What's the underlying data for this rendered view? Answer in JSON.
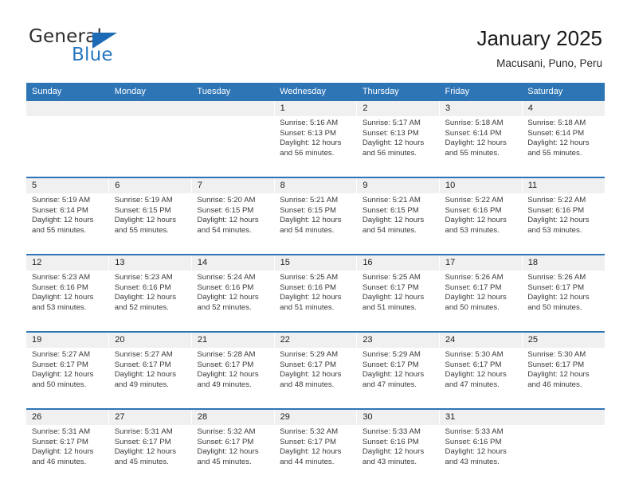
{
  "logo": {
    "word1": "General",
    "word2": "Blue",
    "triangle_color": "#1d6bb5",
    "word2_color": "#2477c0"
  },
  "header": {
    "title": "January 2025",
    "subtitle": "Macusani, Puno, Peru"
  },
  "theme": {
    "header_blue": "#2e75b6",
    "daynum_band": "#f0f0f0",
    "text": "#202020"
  },
  "weekday_headers": [
    "Sunday",
    "Monday",
    "Tuesday",
    "Wednesday",
    "Thursday",
    "Friday",
    "Saturday"
  ],
  "labels": {
    "sunrise_prefix": "Sunrise:",
    "sunset_prefix": "Sunset:",
    "daylight_prefix": "Daylight:"
  },
  "weeks": [
    {
      "days": [
        {
          "num": "",
          "empty": true
        },
        {
          "num": "",
          "empty": true
        },
        {
          "num": "",
          "empty": true
        },
        {
          "num": "1",
          "sunrise": "Sunrise: 5:16 AM",
          "sunset": "Sunset: 6:13 PM",
          "daylight1": "Daylight: 12 hours",
          "daylight2": "and 56 minutes."
        },
        {
          "num": "2",
          "sunrise": "Sunrise: 5:17 AM",
          "sunset": "Sunset: 6:13 PM",
          "daylight1": "Daylight: 12 hours",
          "daylight2": "and 56 minutes."
        },
        {
          "num": "3",
          "sunrise": "Sunrise: 5:18 AM",
          "sunset": "Sunset: 6:14 PM",
          "daylight1": "Daylight: 12 hours",
          "daylight2": "and 55 minutes."
        },
        {
          "num": "4",
          "sunrise": "Sunrise: 5:18 AM",
          "sunset": "Sunset: 6:14 PM",
          "daylight1": "Daylight: 12 hours",
          "daylight2": "and 55 minutes."
        }
      ]
    },
    {
      "days": [
        {
          "num": "5",
          "sunrise": "Sunrise: 5:19 AM",
          "sunset": "Sunset: 6:14 PM",
          "daylight1": "Daylight: 12 hours",
          "daylight2": "and 55 minutes."
        },
        {
          "num": "6",
          "sunrise": "Sunrise: 5:19 AM",
          "sunset": "Sunset: 6:15 PM",
          "daylight1": "Daylight: 12 hours",
          "daylight2": "and 55 minutes."
        },
        {
          "num": "7",
          "sunrise": "Sunrise: 5:20 AM",
          "sunset": "Sunset: 6:15 PM",
          "daylight1": "Daylight: 12 hours",
          "daylight2": "and 54 minutes."
        },
        {
          "num": "8",
          "sunrise": "Sunrise: 5:21 AM",
          "sunset": "Sunset: 6:15 PM",
          "daylight1": "Daylight: 12 hours",
          "daylight2": "and 54 minutes."
        },
        {
          "num": "9",
          "sunrise": "Sunrise: 5:21 AM",
          "sunset": "Sunset: 6:15 PM",
          "daylight1": "Daylight: 12 hours",
          "daylight2": "and 54 minutes."
        },
        {
          "num": "10",
          "sunrise": "Sunrise: 5:22 AM",
          "sunset": "Sunset: 6:16 PM",
          "daylight1": "Daylight: 12 hours",
          "daylight2": "and 53 minutes."
        },
        {
          "num": "11",
          "sunrise": "Sunrise: 5:22 AM",
          "sunset": "Sunset: 6:16 PM",
          "daylight1": "Daylight: 12 hours",
          "daylight2": "and 53 minutes."
        }
      ]
    },
    {
      "days": [
        {
          "num": "12",
          "sunrise": "Sunrise: 5:23 AM",
          "sunset": "Sunset: 6:16 PM",
          "daylight1": "Daylight: 12 hours",
          "daylight2": "and 53 minutes."
        },
        {
          "num": "13",
          "sunrise": "Sunrise: 5:23 AM",
          "sunset": "Sunset: 6:16 PM",
          "daylight1": "Daylight: 12 hours",
          "daylight2": "and 52 minutes."
        },
        {
          "num": "14",
          "sunrise": "Sunrise: 5:24 AM",
          "sunset": "Sunset: 6:16 PM",
          "daylight1": "Daylight: 12 hours",
          "daylight2": "and 52 minutes."
        },
        {
          "num": "15",
          "sunrise": "Sunrise: 5:25 AM",
          "sunset": "Sunset: 6:16 PM",
          "daylight1": "Daylight: 12 hours",
          "daylight2": "and 51 minutes."
        },
        {
          "num": "16",
          "sunrise": "Sunrise: 5:25 AM",
          "sunset": "Sunset: 6:17 PM",
          "daylight1": "Daylight: 12 hours",
          "daylight2": "and 51 minutes."
        },
        {
          "num": "17",
          "sunrise": "Sunrise: 5:26 AM",
          "sunset": "Sunset: 6:17 PM",
          "daylight1": "Daylight: 12 hours",
          "daylight2": "and 50 minutes."
        },
        {
          "num": "18",
          "sunrise": "Sunrise: 5:26 AM",
          "sunset": "Sunset: 6:17 PM",
          "daylight1": "Daylight: 12 hours",
          "daylight2": "and 50 minutes."
        }
      ]
    },
    {
      "days": [
        {
          "num": "19",
          "sunrise": "Sunrise: 5:27 AM",
          "sunset": "Sunset: 6:17 PM",
          "daylight1": "Daylight: 12 hours",
          "daylight2": "and 50 minutes."
        },
        {
          "num": "20",
          "sunrise": "Sunrise: 5:27 AM",
          "sunset": "Sunset: 6:17 PM",
          "daylight1": "Daylight: 12 hours",
          "daylight2": "and 49 minutes."
        },
        {
          "num": "21",
          "sunrise": "Sunrise: 5:28 AM",
          "sunset": "Sunset: 6:17 PM",
          "daylight1": "Daylight: 12 hours",
          "daylight2": "and 49 minutes."
        },
        {
          "num": "22",
          "sunrise": "Sunrise: 5:29 AM",
          "sunset": "Sunset: 6:17 PM",
          "daylight1": "Daylight: 12 hours",
          "daylight2": "and 48 minutes."
        },
        {
          "num": "23",
          "sunrise": "Sunrise: 5:29 AM",
          "sunset": "Sunset: 6:17 PM",
          "daylight1": "Daylight: 12 hours",
          "daylight2": "and 47 minutes."
        },
        {
          "num": "24",
          "sunrise": "Sunrise: 5:30 AM",
          "sunset": "Sunset: 6:17 PM",
          "daylight1": "Daylight: 12 hours",
          "daylight2": "and 47 minutes."
        },
        {
          "num": "25",
          "sunrise": "Sunrise: 5:30 AM",
          "sunset": "Sunset: 6:17 PM",
          "daylight1": "Daylight: 12 hours",
          "daylight2": "and 46 minutes."
        }
      ]
    },
    {
      "days": [
        {
          "num": "26",
          "sunrise": "Sunrise: 5:31 AM",
          "sunset": "Sunset: 6:17 PM",
          "daylight1": "Daylight: 12 hours",
          "daylight2": "and 46 minutes."
        },
        {
          "num": "27",
          "sunrise": "Sunrise: 5:31 AM",
          "sunset": "Sunset: 6:17 PM",
          "daylight1": "Daylight: 12 hours",
          "daylight2": "and 45 minutes."
        },
        {
          "num": "28",
          "sunrise": "Sunrise: 5:32 AM",
          "sunset": "Sunset: 6:17 PM",
          "daylight1": "Daylight: 12 hours",
          "daylight2": "and 45 minutes."
        },
        {
          "num": "29",
          "sunrise": "Sunrise: 5:32 AM",
          "sunset": "Sunset: 6:17 PM",
          "daylight1": "Daylight: 12 hours",
          "daylight2": "and 44 minutes."
        },
        {
          "num": "30",
          "sunrise": "Sunrise: 5:33 AM",
          "sunset": "Sunset: 6:16 PM",
          "daylight1": "Daylight: 12 hours",
          "daylight2": "and 43 minutes."
        },
        {
          "num": "31",
          "sunrise": "Sunrise: 5:33 AM",
          "sunset": "Sunset: 6:16 PM",
          "daylight1": "Daylight: 12 hours",
          "daylight2": "and 43 minutes."
        },
        {
          "num": "",
          "empty": true
        }
      ]
    }
  ]
}
